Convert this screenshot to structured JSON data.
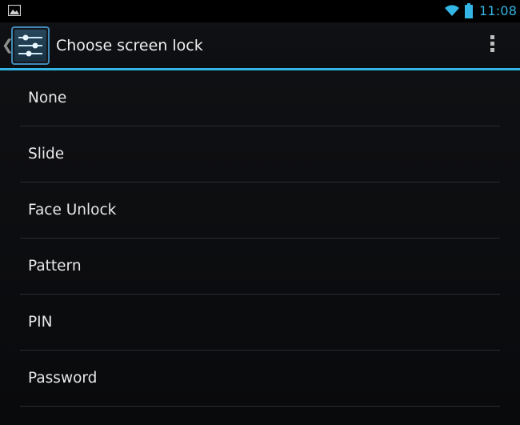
{
  "status_bar": {
    "left_icon": "picture-notification-icon",
    "wifi_icon": "wifi-icon",
    "battery_icon": "battery-icon",
    "time": "11:08",
    "accent_color": "#33b5e5"
  },
  "action_bar": {
    "up_icon": "back-caret-icon",
    "app_icon": "settings-sliders-icon",
    "title": "Choose screen lock",
    "overflow_icon": "overflow-menu-icon"
  },
  "options": [
    {
      "label": "None"
    },
    {
      "label": "Slide"
    },
    {
      "label": "Face Unlock"
    },
    {
      "label": "Pattern"
    },
    {
      "label": "PIN"
    },
    {
      "label": "Password"
    }
  ]
}
